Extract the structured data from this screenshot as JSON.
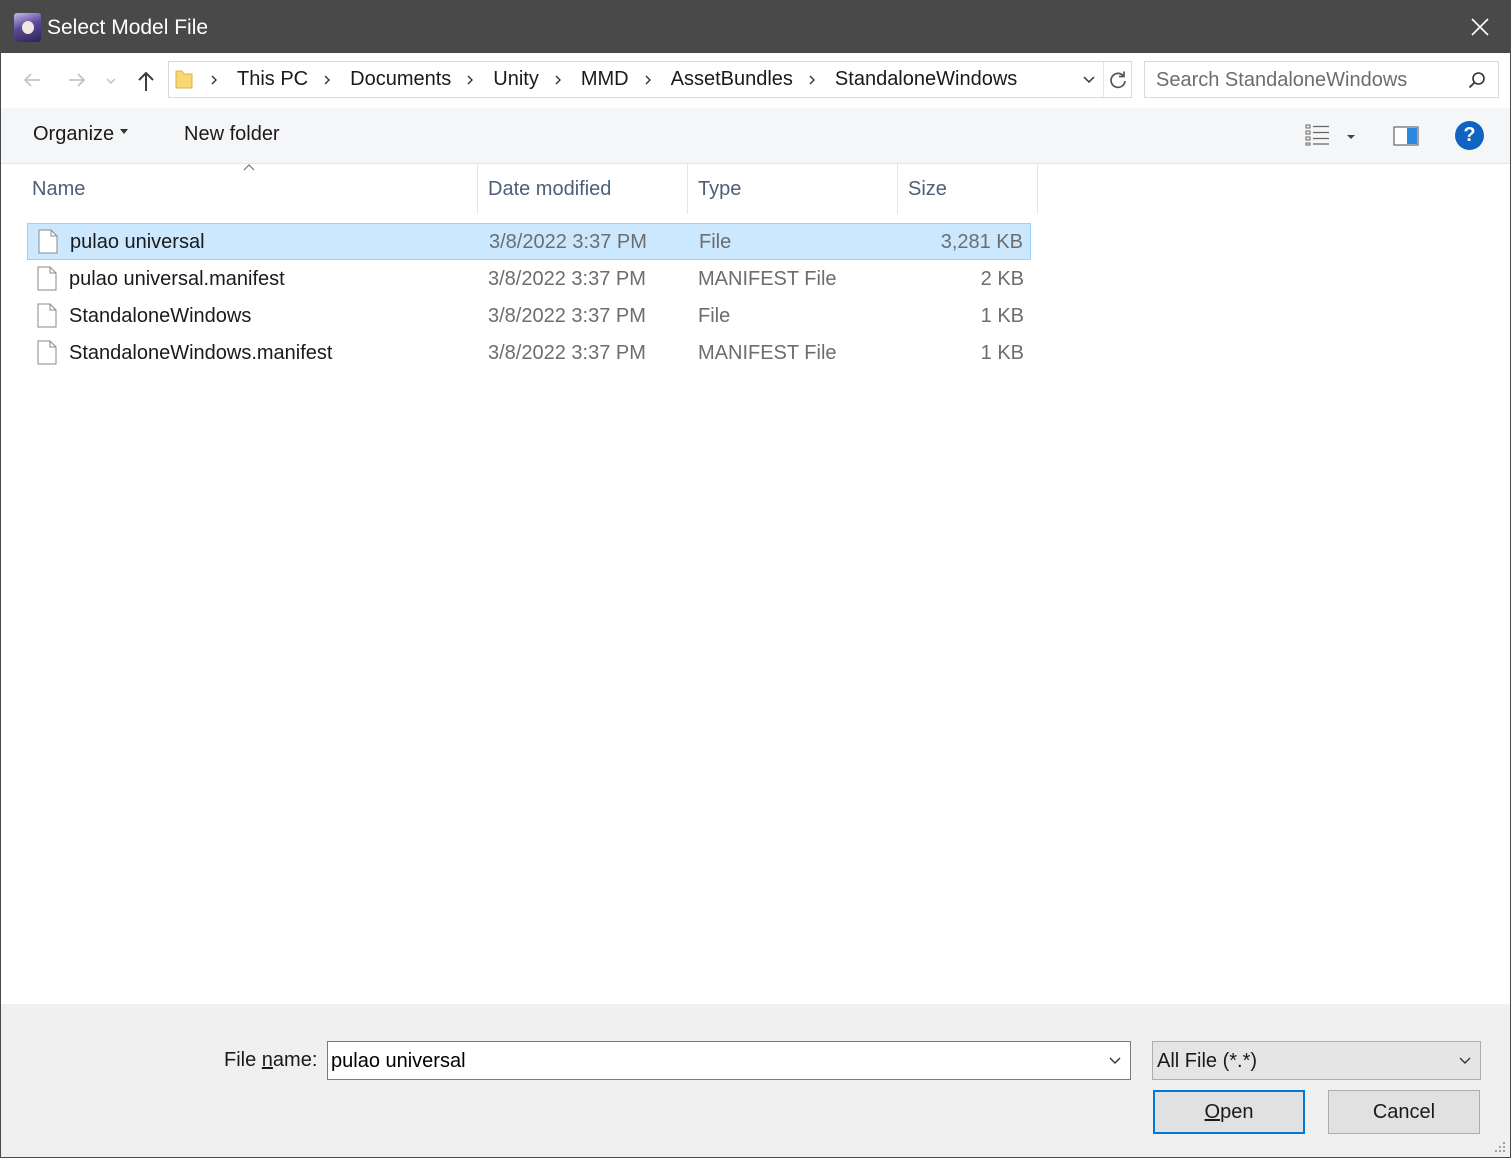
{
  "window": {
    "title": "Select Model File"
  },
  "navigation": {
    "breadcrumbs": [
      "This PC",
      "Documents",
      "Unity",
      "MMD",
      "AssetBundles",
      "StandaloneWindows"
    ],
    "search_placeholder": "Search StandaloneWindows"
  },
  "toolbar": {
    "organize_label": "Organize",
    "new_folder_label": "New folder",
    "help_label": "?"
  },
  "file_list": {
    "columns": {
      "name": "Name",
      "date": "Date modified",
      "type": "Type",
      "size": "Size"
    },
    "rows": [
      {
        "name": "pulao universal",
        "date": "3/8/2022 3:37 PM",
        "type": "File",
        "size": "3,281 KB",
        "selected": true
      },
      {
        "name": "pulao universal.manifest",
        "date": "3/8/2022 3:37 PM",
        "type": "MANIFEST File",
        "size": "2 KB",
        "selected": false
      },
      {
        "name": "StandaloneWindows",
        "date": "3/8/2022 3:37 PM",
        "type": "File",
        "size": "1 KB",
        "selected": false
      },
      {
        "name": "StandaloneWindows.manifest",
        "date": "3/8/2022 3:37 PM",
        "type": "MANIFEST File",
        "size": "1 KB",
        "selected": false
      }
    ]
  },
  "footer": {
    "file_name_label_pre": "File ",
    "file_name_label_mnemonic": "n",
    "file_name_label_post": "ame:",
    "file_name_value": "pulao universal",
    "file_type_value": "All File (*.*)",
    "open_label_mnemonic": "O",
    "open_label_rest": "pen",
    "cancel_label": "Cancel"
  },
  "colors": {
    "titlebar": "#494949",
    "selection_fill": "#cce8ff",
    "selection_border": "#99d1ff",
    "accent": "#0078d7",
    "help_icon": "#1063c1"
  }
}
